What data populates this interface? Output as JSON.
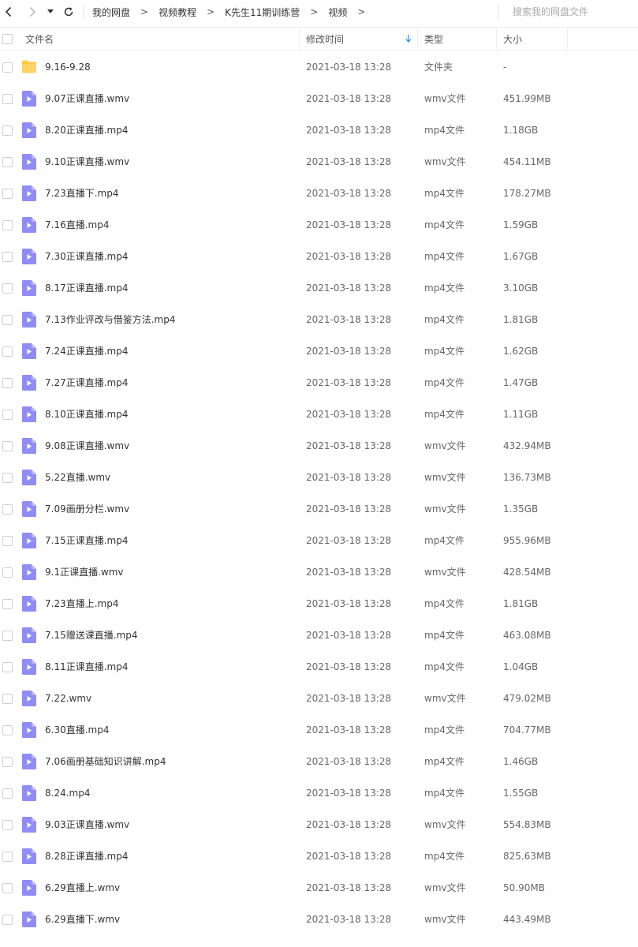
{
  "toolbar": {
    "breadcrumbs": [
      "我的网盘",
      "视频教程",
      "K先生11期训练营",
      "视频"
    ],
    "separator": ">",
    "search_placeholder": "搜索我的网盘文件"
  },
  "columns": {
    "name": "文件名",
    "modified": "修改时间",
    "type": "类型",
    "size": "大小"
  },
  "colors": {
    "folder": "#ffc845",
    "video": "#8f8cf5",
    "sort_arrow": "#2f8ff5"
  },
  "files": [
    {
      "name": "9.16-9.28",
      "modified": "2021-03-18 13:28",
      "type": "文件夹",
      "size": "-",
      "icon": "folder-icon"
    },
    {
      "name": "9.07正课直播.wmv",
      "modified": "2021-03-18 13:28",
      "type": "wmv文件",
      "size": "451.99MB",
      "icon": "video-file-icon"
    },
    {
      "name": "8.20正课直播.mp4",
      "modified": "2021-03-18 13:28",
      "type": "mp4文件",
      "size": "1.18GB",
      "icon": "video-file-icon"
    },
    {
      "name": "9.10正课直播.wmv",
      "modified": "2021-03-18 13:28",
      "type": "wmv文件",
      "size": "454.11MB",
      "icon": "video-file-icon"
    },
    {
      "name": "7.23直播下.mp4",
      "modified": "2021-03-18 13:28",
      "type": "mp4文件",
      "size": "178.27MB",
      "icon": "video-file-icon"
    },
    {
      "name": "7.16直播.mp4",
      "modified": "2021-03-18 13:28",
      "type": "mp4文件",
      "size": "1.59GB",
      "icon": "video-file-icon"
    },
    {
      "name": "7.30正课直播.mp4",
      "modified": "2021-03-18 13:28",
      "type": "mp4文件",
      "size": "1.67GB",
      "icon": "video-file-icon"
    },
    {
      "name": "8.17正课直播.mp4",
      "modified": "2021-03-18 13:28",
      "type": "mp4文件",
      "size": "3.10GB",
      "icon": "video-file-icon"
    },
    {
      "name": "7.13作业评改与借鉴方法.mp4",
      "modified": "2021-03-18 13:28",
      "type": "mp4文件",
      "size": "1.81GB",
      "icon": "video-file-icon"
    },
    {
      "name": "7.24正课直播.mp4",
      "modified": "2021-03-18 13:28",
      "type": "mp4文件",
      "size": "1.62GB",
      "icon": "video-file-icon"
    },
    {
      "name": "7.27正课直播.mp4",
      "modified": "2021-03-18 13:28",
      "type": "mp4文件",
      "size": "1.47GB",
      "icon": "video-file-icon"
    },
    {
      "name": "8.10正课直播.mp4",
      "modified": "2021-03-18 13:28",
      "type": "mp4文件",
      "size": "1.11GB",
      "icon": "video-file-icon"
    },
    {
      "name": "9.08正课直播.wmv",
      "modified": "2021-03-18 13:28",
      "type": "wmv文件",
      "size": "432.94MB",
      "icon": "video-file-icon"
    },
    {
      "name": "5.22直播.wmv",
      "modified": "2021-03-18 13:28",
      "type": "wmv文件",
      "size": "136.73MB",
      "icon": "video-file-icon"
    },
    {
      "name": "7.09画册分栏.wmv",
      "modified": "2021-03-18 13:28",
      "type": "wmv文件",
      "size": "1.35GB",
      "icon": "video-file-icon"
    },
    {
      "name": "7.15正课直播.mp4",
      "modified": "2021-03-18 13:28",
      "type": "mp4文件",
      "size": "955.96MB",
      "icon": "video-file-icon"
    },
    {
      "name": "9.1正课直播.wmv",
      "modified": "2021-03-18 13:28",
      "type": "wmv文件",
      "size": "428.54MB",
      "icon": "video-file-icon"
    },
    {
      "name": "7.23直播上.mp4",
      "modified": "2021-03-18 13:28",
      "type": "mp4文件",
      "size": "1.81GB",
      "icon": "video-file-icon"
    },
    {
      "name": "7.15赠送课直播.mp4",
      "modified": "2021-03-18 13:28",
      "type": "mp4文件",
      "size": "463.08MB",
      "icon": "video-file-icon"
    },
    {
      "name": "8.11正课直播.mp4",
      "modified": "2021-03-18 13:28",
      "type": "mp4文件",
      "size": "1.04GB",
      "icon": "video-file-icon"
    },
    {
      "name": "7.22.wmv",
      "modified": "2021-03-18 13:28",
      "type": "wmv文件",
      "size": "479.02MB",
      "icon": "video-file-icon"
    },
    {
      "name": "6.30直播.mp4",
      "modified": "2021-03-18 13:28",
      "type": "mp4文件",
      "size": "704.77MB",
      "icon": "video-file-icon"
    },
    {
      "name": "7.06画册基础知识讲解.mp4",
      "modified": "2021-03-18 13:28",
      "type": "mp4文件",
      "size": "1.46GB",
      "icon": "video-file-icon"
    },
    {
      "name": "8.24.mp4",
      "modified": "2021-03-18 13:28",
      "type": "mp4文件",
      "size": "1.55GB",
      "icon": "video-file-icon"
    },
    {
      "name": "9.03正课直播.wmv",
      "modified": "2021-03-18 13:28",
      "type": "wmv文件",
      "size": "554.83MB",
      "icon": "video-file-icon"
    },
    {
      "name": "8.28正课直播.mp4",
      "modified": "2021-03-18 13:28",
      "type": "mp4文件",
      "size": "825.63MB",
      "icon": "video-file-icon"
    },
    {
      "name": "6.29直播上.wmv",
      "modified": "2021-03-18 13:28",
      "type": "wmv文件",
      "size": "50.90MB",
      "icon": "video-file-icon"
    },
    {
      "name": "6.29直播下.wmv",
      "modified": "2021-03-18 13:28",
      "type": "wmv文件",
      "size": "443.49MB",
      "icon": "video-file-icon"
    }
  ]
}
